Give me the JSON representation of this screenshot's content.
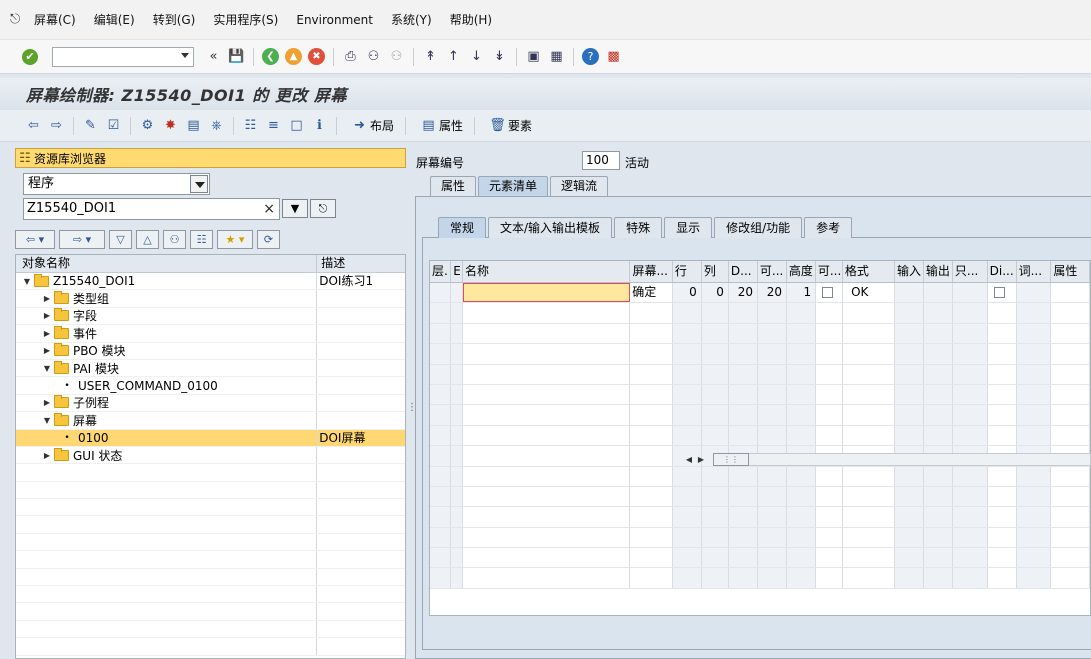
{
  "menu": {
    "items": [
      "屏幕(C)",
      "编辑(E)",
      "转到(G)",
      "实用程序(S)",
      "Environment",
      "系统(Y)",
      "帮助(H)"
    ]
  },
  "system_toolbar": {
    "command_field_value": "",
    "icons": [
      "enter-icon",
      "command-field",
      "save-icon",
      "back-icon",
      "exit-icon",
      "cancel-icon",
      "print-icon",
      "find-icon",
      "find-next-icon",
      "first-page-icon",
      "prev-page-icon",
      "next-page-icon",
      "last-page-icon",
      "new-session-icon",
      "shortcut-icon",
      "help-icon",
      "customize-icon"
    ]
  },
  "title": "屏幕绘制器: Z15540_DOI1 的 更改 屏幕",
  "app_toolbar": {
    "layout_label": "布局",
    "attributes_label": "属性",
    "elements_label": "要素"
  },
  "left": {
    "repo_browser_label": "资源库浏览器",
    "object_type": "程序",
    "object_name": "Z15540_DOI1",
    "tree_columns": [
      "对象名称",
      "描述"
    ],
    "tree": [
      {
        "level": 0,
        "expanded": true,
        "type": "folder",
        "name": "Z15540_DOI1",
        "desc": "DOI练习1"
      },
      {
        "level": 1,
        "expanded": false,
        "type": "folder",
        "name": "类型组",
        "desc": ""
      },
      {
        "level": 1,
        "expanded": false,
        "type": "folder",
        "name": "字段",
        "desc": ""
      },
      {
        "level": 1,
        "expanded": false,
        "type": "folder",
        "name": "事件",
        "desc": ""
      },
      {
        "level": 1,
        "expanded": false,
        "type": "folder",
        "name": "PBO 模块",
        "desc": ""
      },
      {
        "level": 1,
        "expanded": true,
        "type": "folder",
        "name": "PAI 模块",
        "desc": ""
      },
      {
        "level": 2,
        "expanded": false,
        "type": "leaf",
        "name": "USER_COMMAND_0100",
        "desc": ""
      },
      {
        "level": 1,
        "expanded": false,
        "type": "folder",
        "name": "子例程",
        "desc": ""
      },
      {
        "level": 1,
        "expanded": true,
        "type": "folder",
        "name": "屏幕",
        "desc": ""
      },
      {
        "level": 2,
        "expanded": false,
        "type": "leaf",
        "name": "0100",
        "desc": "DOI屏幕",
        "selected": true
      },
      {
        "level": 1,
        "expanded": false,
        "type": "folder",
        "name": "GUI 状态",
        "desc": ""
      }
    ]
  },
  "right": {
    "screen_number_label": "屏幕编号",
    "screen_number": "100",
    "status": "活动",
    "outer_tabs": [
      "属性",
      "元素清单",
      "逻辑流"
    ],
    "outer_active": 1,
    "inner_tabs": [
      "常规",
      "文本/输入输出模板",
      "特殊",
      "显示",
      "修改组/功能",
      "参考"
    ],
    "inner_active": 0,
    "grid_columns": [
      "层.",
      "E",
      "名称",
      "屏幕...",
      "行",
      "列",
      "D...",
      "可...",
      "高度",
      "可...",
      "格式",
      "输入",
      "输出",
      "只...",
      "Di...",
      "词...",
      "属性"
    ],
    "grid_rows": [
      [
        "",
        "",
        "",
        "确定",
        "0",
        "0",
        "20",
        "20",
        "1",
        "",
        "OK",
        "",
        "",
        "",
        "",
        "",
        ""
      ]
    ]
  }
}
